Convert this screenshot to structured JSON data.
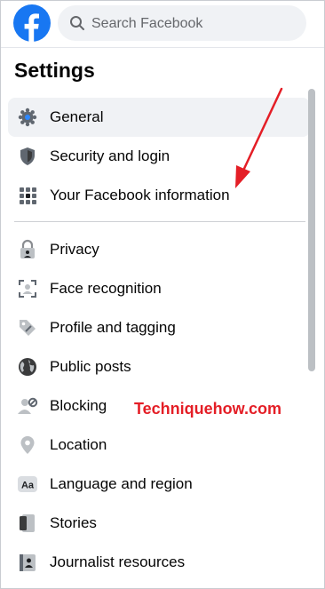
{
  "header": {
    "logo_icon": "facebook-logo",
    "search": {
      "placeholder": "Search Facebook",
      "value": "",
      "icon": "search-icon"
    }
  },
  "page_title": "Settings",
  "settings_group_1": [
    {
      "label": "General",
      "icon": "gear-icon",
      "active": true
    },
    {
      "label": "Security and login",
      "icon": "shield-icon",
      "active": false
    },
    {
      "label": "Your Facebook information",
      "icon": "grid-icon",
      "active": false
    }
  ],
  "settings_group_2": [
    {
      "label": "Privacy",
      "icon": "lock-icon"
    },
    {
      "label": "Face recognition",
      "icon": "face-scan-icon"
    },
    {
      "label": "Profile and tagging",
      "icon": "tag-icon"
    },
    {
      "label": "Public posts",
      "icon": "globe-icon"
    },
    {
      "label": "Blocking",
      "icon": "block-user-icon"
    },
    {
      "label": "Location",
      "icon": "location-pin-icon"
    },
    {
      "label": "Language and region",
      "icon": "language-icon"
    },
    {
      "label": "Stories",
      "icon": "book-icon"
    },
    {
      "label": "Journalist resources",
      "icon": "id-card-icon"
    }
  ],
  "watermark": "Techniquehow.com",
  "colors": {
    "brand": "#1877f2",
    "active_bg": "#f0f2f5",
    "annotation": "#e41e26"
  }
}
